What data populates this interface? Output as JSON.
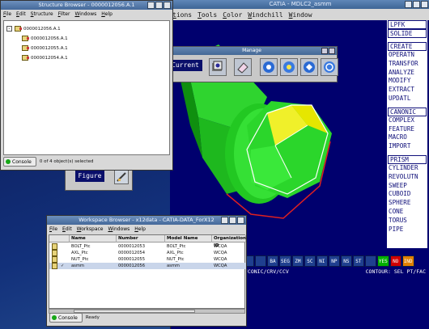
{
  "catia": {
    "title": "CATIA - MDLC2_asmm",
    "menu": [
      "tions",
      "Tools",
      "Color",
      "Windchill",
      "Window"
    ],
    "panel": {
      "group1": [
        "LPFK",
        "SOLIDE"
      ],
      "group2": [
        "CREATE",
        "OPERATN",
        "TRANSFOR",
        "ANALYZE",
        "MODIFY",
        "EXTRACT",
        "UPDATL"
      ],
      "group3": [
        "CANONIC",
        "COMPLEX",
        "FEATURE",
        "MACRO",
        "IMPORT"
      ],
      "group4": [
        "PRISM",
        "CYLINDER",
        "REVOLUTN",
        "SWEEP",
        "CUBOID",
        "SPHERE",
        "CONE",
        "TORUS",
        "PIPE"
      ]
    },
    "bottom_buttons": [
      "BA",
      "SEG",
      "ZM",
      "SC",
      "NI",
      "NP",
      "NS",
      "ST"
    ],
    "yes_label": "YES",
    "no_label": "NO",
    "ind_label": "IND",
    "status_left": "/CONIC/CRV/CCV",
    "status_right": "CONTOUR: SEL PT/FAC"
  },
  "manage": {
    "title": "Manage",
    "current_label": "Current"
  },
  "figure": {
    "label": "Figure"
  },
  "structure_browser": {
    "title": "Structure Browser - 0000012056.A.1",
    "menu": [
      "File",
      "Edit",
      "Structure",
      "Filter",
      "Windows",
      "Help"
    ],
    "root": "0000012056.A.1",
    "children": [
      "0000012056.A.1",
      "0000012055.A.1",
      "0000012054.A.1"
    ],
    "console_label": "Console",
    "status": "0 of 4 object(s) selected"
  },
  "workspace_browser": {
    "title": "Workspace Browser - x12data - CATIA-DATA_ForX12",
    "menu": [
      "File",
      "Edit",
      "Workspace",
      "Windows",
      "Help"
    ],
    "columns": [
      "Name",
      "Number",
      "Model Name",
      "Organization ID"
    ],
    "rows": [
      {
        "name": "BOLT_Ptc",
        "number": "0000012053",
        "model": "BOLT_Ptc",
        "org": "WCQA"
      },
      {
        "name": "AXL_Ptc",
        "number": "0000012054",
        "model": "AXL_Ptc",
        "org": "WCQA"
      },
      {
        "name": "NUT_Ptc",
        "number": "0000012055",
        "model": "NUT_Ptc",
        "org": "WCQA"
      },
      {
        "name": "asmm",
        "number": "0000012056",
        "model": "asmm",
        "org": "WCQA"
      }
    ],
    "console_label": "Console",
    "status": "Ready"
  }
}
